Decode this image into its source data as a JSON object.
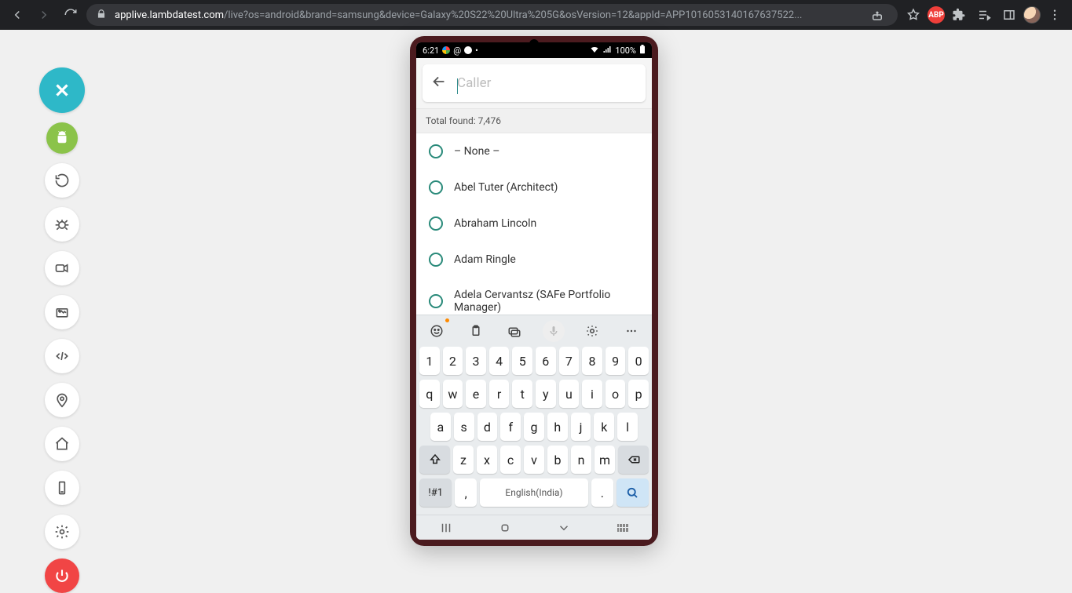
{
  "chrome": {
    "url_host": "applive.lambdatest.com",
    "url_path": "/live?os=android&brand=samsung&device=Galaxy%20S22%20Ultra%205G&osVersion=12&appId=APP1016053140167637522...",
    "ext_badge": "ABP"
  },
  "sidebar": {
    "close": "close",
    "android": "android",
    "rotate": "rotate",
    "bug": "bug",
    "video": "video",
    "screenshot": "screenshot",
    "devtools": "devtools",
    "location": "location",
    "home": "home",
    "device": "device",
    "settings": "settings",
    "power": "power"
  },
  "status_bar": {
    "time": "6:21",
    "battery_text": "100%"
  },
  "search": {
    "placeholder": "Caller"
  },
  "results": {
    "total_label": "Total found: 7,476",
    "items": [
      {
        "label": "– None –"
      },
      {
        "label": "Abel Tuter (Architect)"
      },
      {
        "label": "Abraham Lincoln"
      },
      {
        "label": "Adam Ringle"
      },
      {
        "label": "Adela Cervantsz (SAFe Portfolio Manager)"
      }
    ]
  },
  "keyboard": {
    "row_num": [
      "1",
      "2",
      "3",
      "4",
      "5",
      "6",
      "7",
      "8",
      "9",
      "0"
    ],
    "row_top": [
      "q",
      "w",
      "e",
      "r",
      "t",
      "y",
      "u",
      "i",
      "o",
      "p"
    ],
    "row_mid": [
      "a",
      "s",
      "d",
      "f",
      "g",
      "h",
      "j",
      "k",
      "l"
    ],
    "row_bot": [
      "z",
      "x",
      "c",
      "v",
      "b",
      "n",
      "m"
    ],
    "sym_key": "!#1",
    "comma_key": ",",
    "space_key": "English(India)",
    "period_key": "."
  }
}
